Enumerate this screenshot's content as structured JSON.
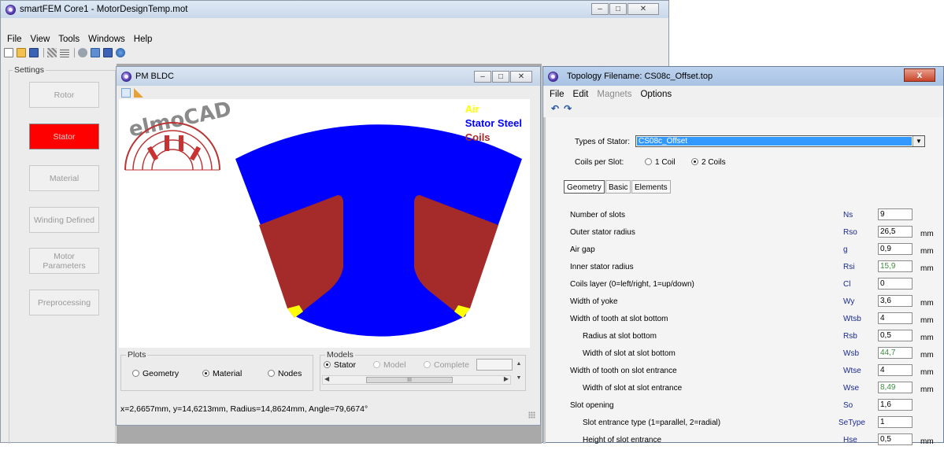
{
  "main_window": {
    "title": "smartFEM Core1  -  MotorDesignTemp.mot",
    "menu": [
      "File",
      "View",
      "Tools",
      "Windows",
      "Help"
    ],
    "settings_label": "Settings",
    "buttons": [
      {
        "label": "Rotor",
        "active": false
      },
      {
        "label": "Stator",
        "active": true
      },
      {
        "label": "Material",
        "active": false
      },
      {
        "label": "Winding Defined",
        "active": false
      },
      {
        "label": "Motor Parameters",
        "active": false
      },
      {
        "label": "Preprocessing",
        "active": false
      }
    ],
    "window_buttons": [
      "–",
      "□",
      "✕"
    ]
  },
  "pm_window": {
    "title": "PM BLDC",
    "logo_text": "elmoCAD",
    "legend": [
      {
        "label": "Air",
        "color": "#ffff00"
      },
      {
        "label": "Stator Steel",
        "color": "#0000ff"
      },
      {
        "label": "Coils",
        "color": "#a52a2a"
      }
    ],
    "plots": {
      "label": "Plots",
      "options": [
        "Geometry",
        "Material",
        "Nodes"
      ],
      "selected": "Material"
    },
    "models": {
      "label": "Models",
      "options": [
        "Stator",
        "Model",
        "Complete"
      ],
      "selected": "Stator"
    },
    "status": "x=2,6657mm,  y=14,6213mm,  Radius=14,8624mm,  Angle=79,6674°",
    "scroll_thumb": "III",
    "window_buttons": [
      "–",
      "□",
      "✕"
    ]
  },
  "topology_window": {
    "title": "Topology Filename: CS08c_Offset.top",
    "menu": [
      {
        "label": "File",
        "enabled": true
      },
      {
        "label": "Edit",
        "enabled": true
      },
      {
        "label": "Magnets",
        "enabled": false
      },
      {
        "label": "Options",
        "enabled": true
      }
    ],
    "close_label": "x",
    "types_label": "Types of Stator:",
    "types_value": "CS08c_Offset",
    "coils_label": "Coils per Slot:",
    "coil_options": [
      "1 Coil",
      "2 Coils"
    ],
    "coil_selected": "2 Coils",
    "tabs": [
      "Geometry",
      "Basic",
      "Elements"
    ],
    "active_tab": "Geometry",
    "params": [
      {
        "label": "Number of slots",
        "symbol": "Ns",
        "value": "9",
        "unit": "",
        "indent": false,
        "computed": false
      },
      {
        "label": "Outer stator radius",
        "symbol": "Rso",
        "value": "26,5",
        "unit": "mm",
        "indent": false,
        "computed": false
      },
      {
        "label": "Air gap",
        "symbol": "g",
        "value": "0,9",
        "unit": "mm",
        "indent": false,
        "computed": false
      },
      {
        "label": "Inner stator radius",
        "symbol": "Rsi",
        "value": "15,9",
        "unit": "mm",
        "indent": false,
        "computed": true
      },
      {
        "label": "Coils layer (0=left/right, 1=up/down)",
        "symbol": "Cl",
        "value": "0",
        "unit": "",
        "indent": false,
        "computed": false
      },
      {
        "label": "Width of yoke",
        "symbol": "Wy",
        "value": "3,6",
        "unit": "mm",
        "indent": false,
        "computed": false
      },
      {
        "label": "Width of tooth at slot bottom",
        "symbol": "Wtsb",
        "value": "4",
        "unit": "mm",
        "indent": false,
        "computed": false
      },
      {
        "label": "Radius at slot bottom",
        "symbol": "Rsb",
        "value": "0,5",
        "unit": "mm",
        "indent": true,
        "computed": false
      },
      {
        "label": "Width of slot at slot bottom",
        "symbol": "Wsb",
        "value": "44,7",
        "unit": "mm",
        "indent": true,
        "computed": true
      },
      {
        "label": "Width of tooth on slot entrance",
        "symbol": "Wtse",
        "value": "4",
        "unit": "mm",
        "indent": false,
        "computed": false
      },
      {
        "label": "Width of slot at slot entrance",
        "symbol": "Wse",
        "value": "8,49",
        "unit": "mm",
        "indent": true,
        "computed": true
      },
      {
        "label": "Slot opening",
        "symbol": "So",
        "value": "1,6",
        "unit": "",
        "indent": false,
        "computed": false
      },
      {
        "label": "Slot entrance type (1=parallel, 2=radial)",
        "symbol": "SeType",
        "value": "1",
        "unit": "",
        "indent": true,
        "computed": false
      },
      {
        "label": "Height of slot entrance",
        "symbol": "Hse",
        "value": "0,5",
        "unit": "mm",
        "indent": true,
        "computed": false
      }
    ]
  }
}
